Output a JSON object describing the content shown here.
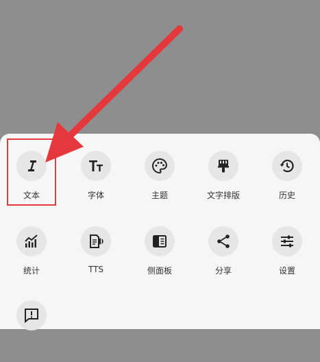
{
  "menu": {
    "items": [
      {
        "label": "文本"
      },
      {
        "label": "字体"
      },
      {
        "label": "主题"
      },
      {
        "label": "文字排版"
      },
      {
        "label": "历史"
      },
      {
        "label": "统计"
      },
      {
        "label": "TTS"
      },
      {
        "label": "侧面板"
      },
      {
        "label": "分享"
      },
      {
        "label": "设置"
      }
    ]
  },
  "colors": {
    "overlay": "#8e8e8e",
    "sheet": "#f6f6f6",
    "icon_bg": "#e6e6e6",
    "highlight": "#e5383c"
  }
}
